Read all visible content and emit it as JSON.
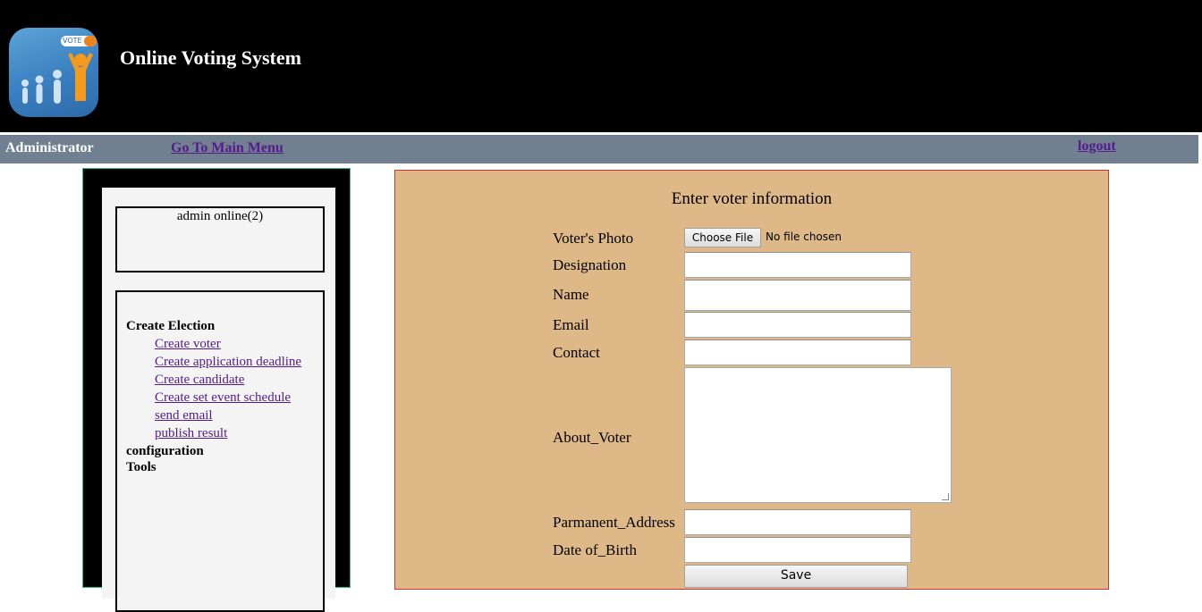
{
  "header": {
    "app_title": "Online Voting System",
    "logo_badge_text": "VOTE"
  },
  "navbar": {
    "role": "Administrator",
    "main_menu_label": "Go To Main Menu",
    "logout_label": "logout"
  },
  "sidebar": {
    "online_status": "admin online(2)",
    "sections": {
      "create_election": "Create Election",
      "configuration": "configuration",
      "tools": "Tools"
    },
    "links": [
      "Create voter",
      "Create application deadline",
      "Create candidate",
      "Create set event schedule",
      "send email",
      "publish result"
    ]
  },
  "form": {
    "title": "Enter voter information",
    "photo_label": "Voter's Photo",
    "choose_file_label": "Choose File",
    "file_status": "No file chosen",
    "designation_label": "Designation",
    "name_label": "Name",
    "email_label": "Email",
    "contact_label": "Contact",
    "about_label": "About_Voter",
    "address_label": "Parmanent_Address",
    "dob_label": "Date of_Birth",
    "save_label": "Save",
    "designation_value": "",
    "name_value": "",
    "email_value": "",
    "contact_value": "",
    "about_value": "",
    "address_value": "",
    "dob_value": ""
  },
  "colors": {
    "header_bg": "#000000",
    "navbar_bg": "#708090",
    "form_bg": "#deb887",
    "form_border": "#cc3333",
    "link": "#551a8b"
  }
}
